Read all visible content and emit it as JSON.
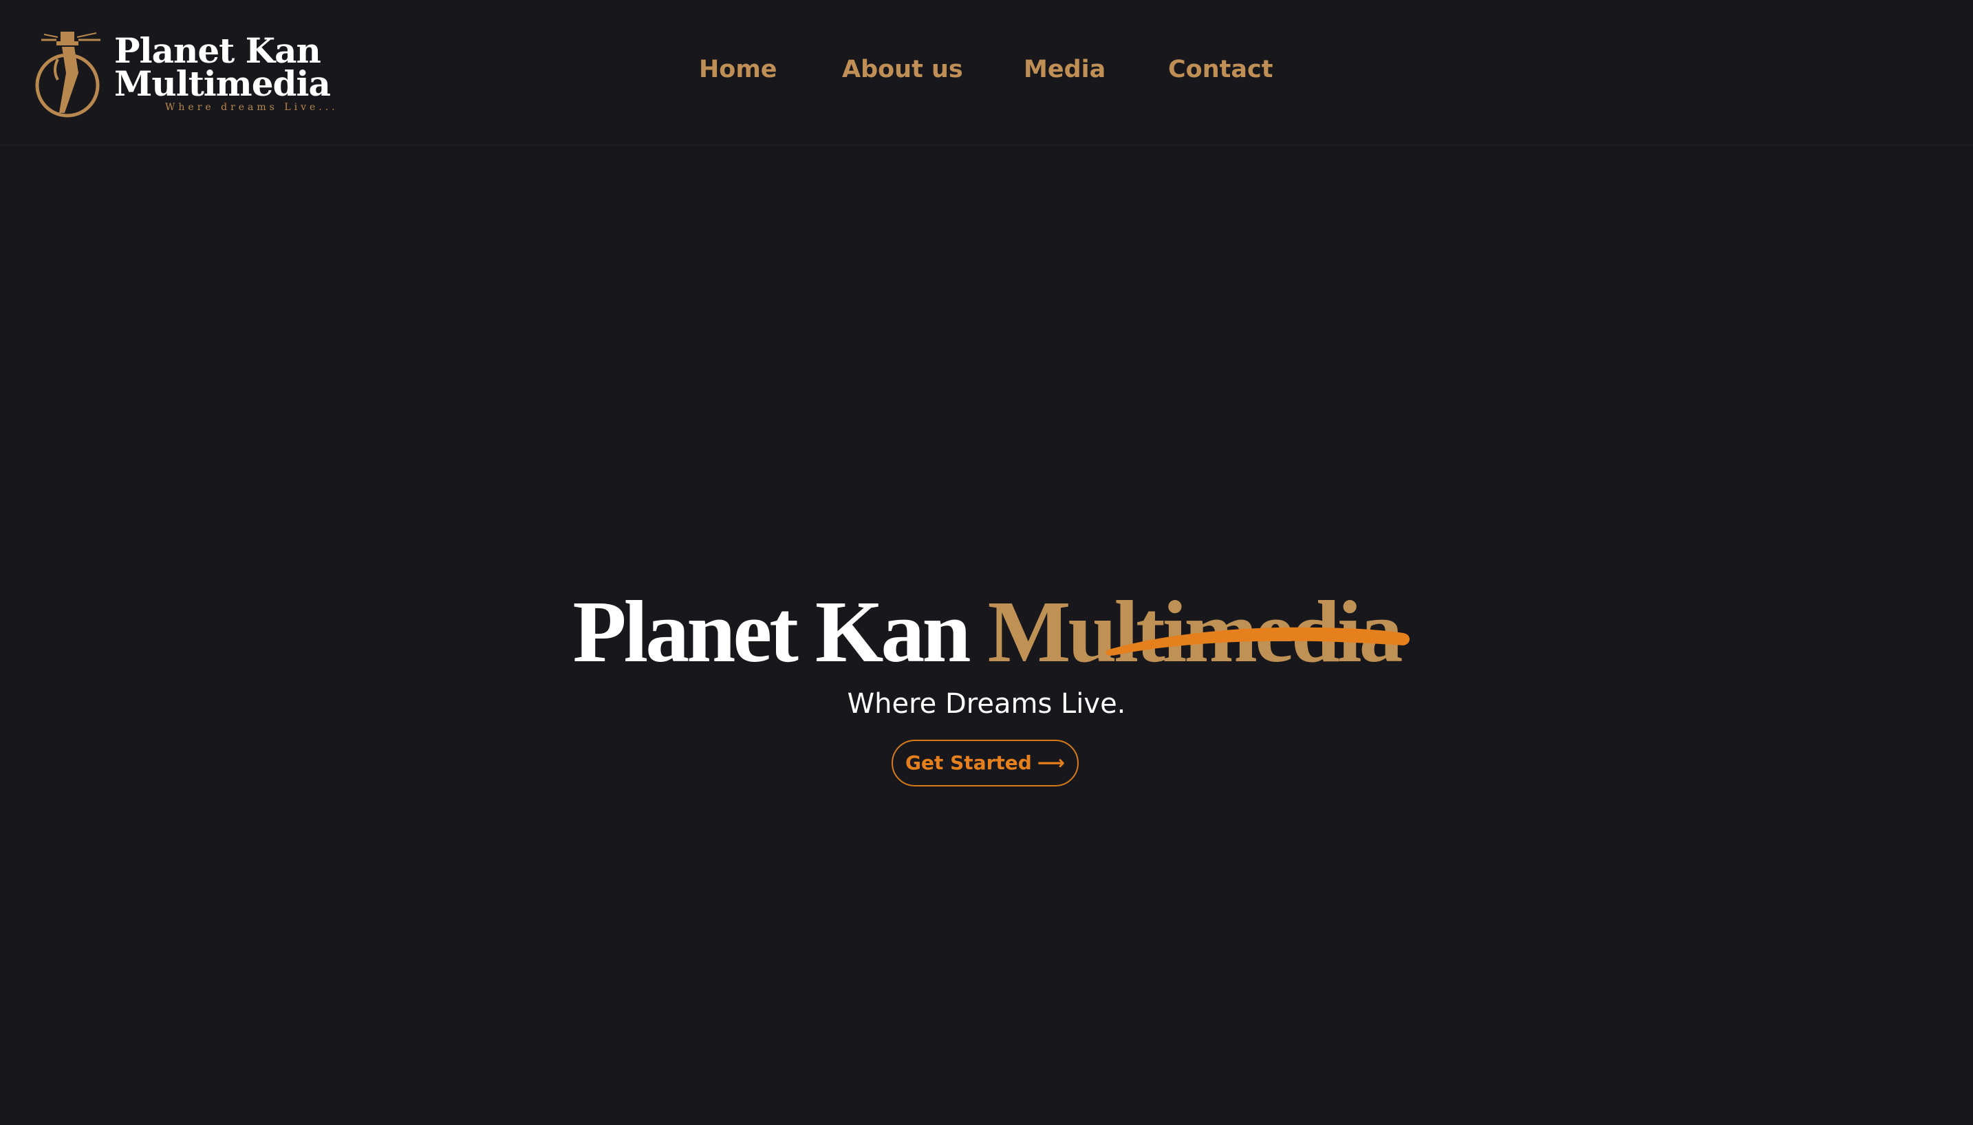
{
  "header": {
    "logo": {
      "line1": "Planet Kan",
      "line2": "Multimedia",
      "tagline": "Where dreams Live..."
    },
    "nav": [
      {
        "label": "Home"
      },
      {
        "label": "About us"
      },
      {
        "label": "Media"
      },
      {
        "label": "Contact"
      }
    ]
  },
  "hero": {
    "title_part1": "Planet Kan",
    "title_part2": "Multimedia",
    "subtitle": "Where Dreams Live.",
    "cta_label": "Get Started",
    "cta_icon": "arrow-right-icon",
    "cta_arrow": "⟶"
  },
  "colors": {
    "background": "#18181c",
    "gold": "#c09155",
    "accent_orange": "#e5801d",
    "text": "#ffffff"
  }
}
